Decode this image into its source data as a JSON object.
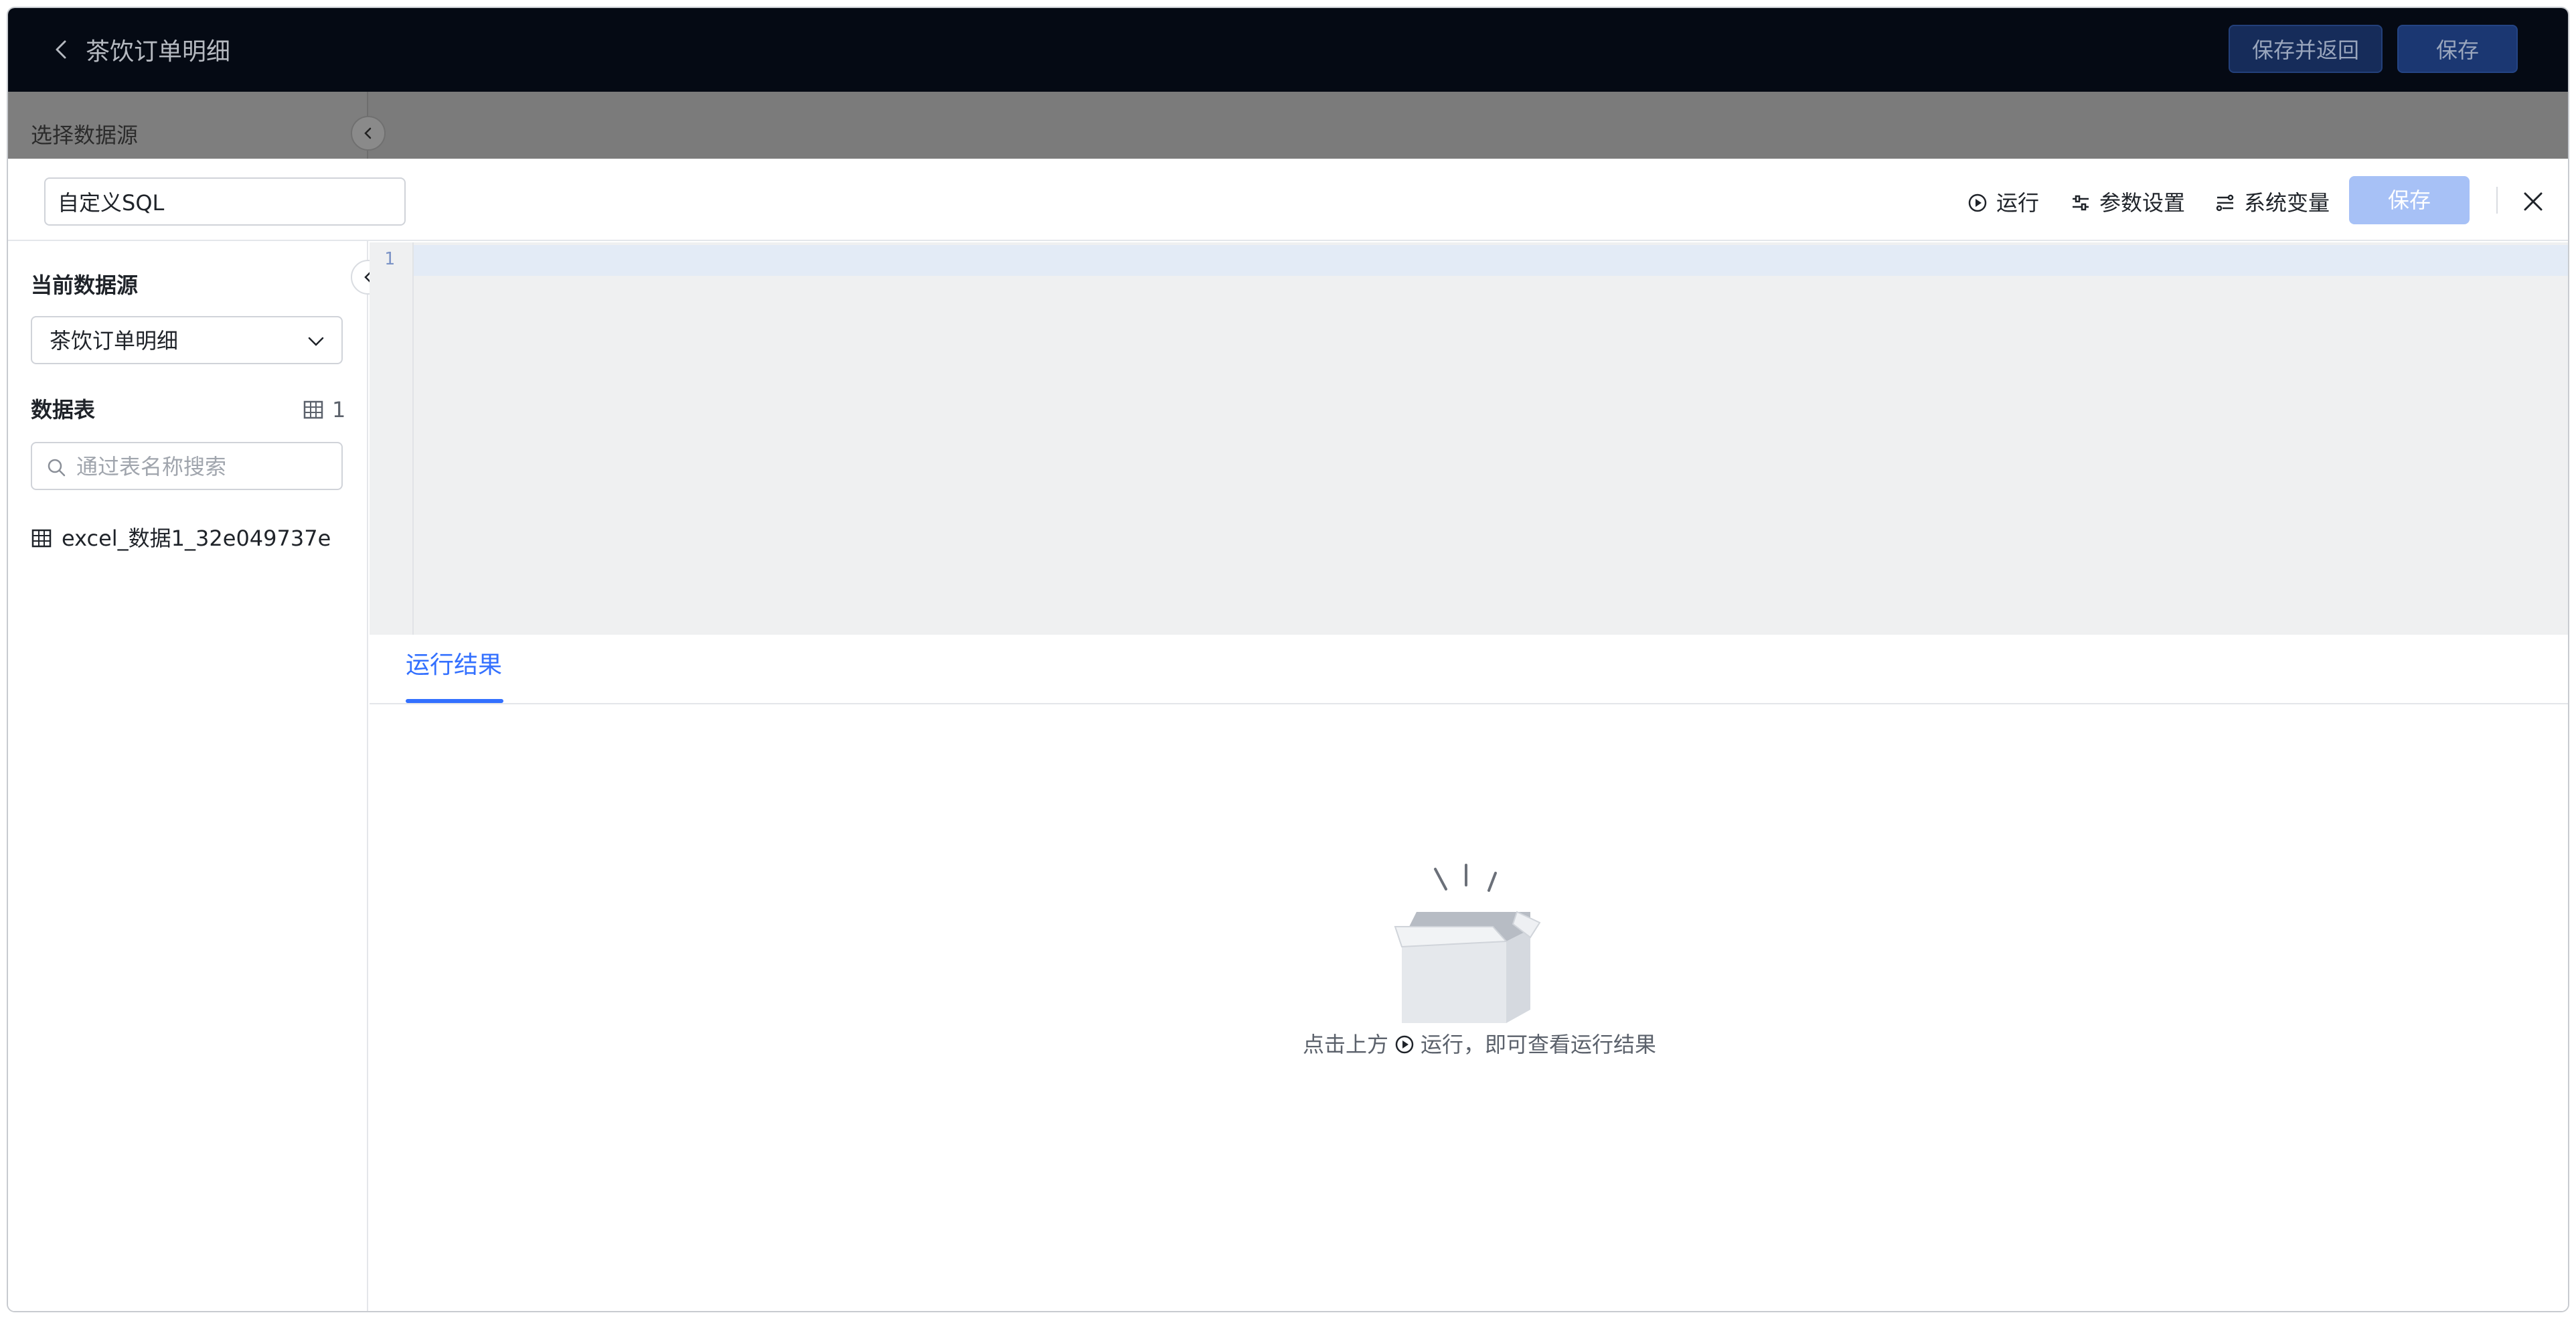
{
  "header": {
    "title": "茶饮订单明细",
    "save_return_label": "保存并返回",
    "save_label": "保存"
  },
  "dimmed": {
    "select_source_label": "选择数据源"
  },
  "drawer": {
    "name_value": "自定义SQL",
    "toolbar": {
      "run_label": "运行",
      "params_label": "参数设置",
      "sysvar_label": "系统变量",
      "save_label": "保存"
    }
  },
  "left_panel": {
    "current_source_title": "当前数据源",
    "current_source_value": "茶饮订单明细",
    "tables_title": "数据表",
    "tables_count": "1",
    "search_placeholder": "通过表名称搜索",
    "tables": [
      {
        "name": "excel_数据1_32e049737e"
      }
    ]
  },
  "editor": {
    "line_numbers": [
      "1"
    ]
  },
  "results": {
    "tab_label": "运行结果",
    "empty_prefix": "点击上方",
    "empty_suffix": "运行，即可查看运行结果"
  },
  "colors": {
    "accent": "#3370ff",
    "header_bg": "#050a14",
    "save_disabled": "#a7c1f6"
  }
}
